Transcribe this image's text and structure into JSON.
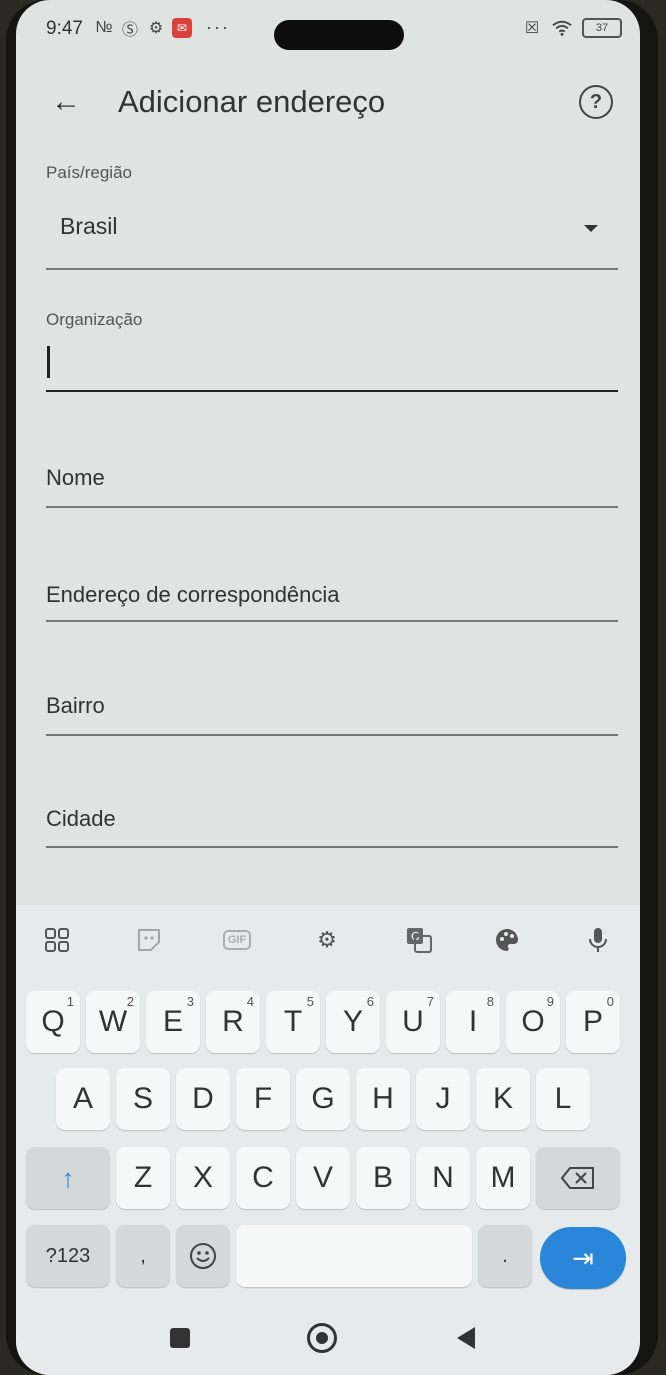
{
  "status_bar": {
    "time": "9:47",
    "battery": "37"
  },
  "app_bar": {
    "back_icon": "arrow-left-icon",
    "title": "Adicionar endereço",
    "help_icon": "help-circle-icon"
  },
  "form": {
    "country_label": "País/região",
    "country_value": "Brasil",
    "organization_label": "Organização",
    "organization_value": "",
    "name_placeholder": "Nome",
    "address_placeholder": "Endereço de correspondência",
    "neighborhood_placeholder": "Bairro",
    "city_placeholder": "Cidade"
  },
  "keyboard_toolbar": {
    "gif_label": "GIF",
    "icons": [
      "apps-grid-icon",
      "sticker-icon",
      "gif-icon",
      "settings-gear-icon",
      "translate-icon",
      "palette-icon",
      "microphone-icon"
    ]
  },
  "keyboard": {
    "row1": [
      {
        "key": "Q",
        "num": "1"
      },
      {
        "key": "W",
        "num": "2"
      },
      {
        "key": "E",
        "num": "3"
      },
      {
        "key": "R",
        "num": "4"
      },
      {
        "key": "T",
        "num": "5"
      },
      {
        "key": "Y",
        "num": "6"
      },
      {
        "key": "U",
        "num": "7"
      },
      {
        "key": "I",
        "num": "8"
      },
      {
        "key": "O",
        "num": "9"
      },
      {
        "key": "P",
        "num": "0"
      }
    ],
    "row2": [
      "A",
      "S",
      "D",
      "F",
      "G",
      "H",
      "J",
      "K",
      "L"
    ],
    "row3": [
      "Z",
      "X",
      "C",
      "V",
      "B",
      "N",
      "M"
    ],
    "symbols_key": "?123",
    "comma_key": ",",
    "period_key": ".",
    "shift_icon": "shift-arrow-icon",
    "backspace_icon": "backspace-icon",
    "emoji_icon": "emoji-icon",
    "enter_icon": "next-tab-icon",
    "accent_color": "#2a86d8"
  },
  "nav_bar": {
    "icons": [
      "recents-square-icon",
      "home-circle-icon",
      "back-triangle-icon"
    ]
  }
}
